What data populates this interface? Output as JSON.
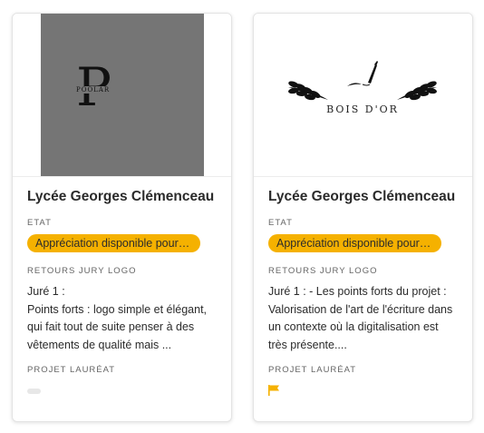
{
  "cards": [
    {
      "logo_text": "POOLAR",
      "logo_letter": "P",
      "title": "Lycée Georges Clémenceau",
      "etat_label": "ETAT",
      "etat_value": "Appréciation disponible pour le jury",
      "retours_label": "RETOURS JURY LOGO",
      "review_line1": "Juré 1 :",
      "review_rest": "Points forts : logo simple et élégant, qui fait tout de suite penser à des vêtements de qualité mais ...",
      "laureat_label": "PROJET LAURÉAT",
      "laureat_icon": "toggle-off-icon"
    },
    {
      "logo_text": "BOIS D'OR",
      "title": "Lycée Georges Clémenceau",
      "etat_label": "ETAT",
      "etat_value": "Appréciation disponible pour le jury",
      "retours_label": "RETOURS JURY LOGO",
      "review": "Juré 1 : - Les points forts du projet : Valorisation de l'art de l'écriture dans un contexte où la digitalisation est très présente....",
      "laureat_label": "PROJET LAURÉAT",
      "laureat_icon": "flag-icon"
    }
  ],
  "colors": {
    "accent": "#f5b100",
    "logo_bg": "#757575"
  }
}
